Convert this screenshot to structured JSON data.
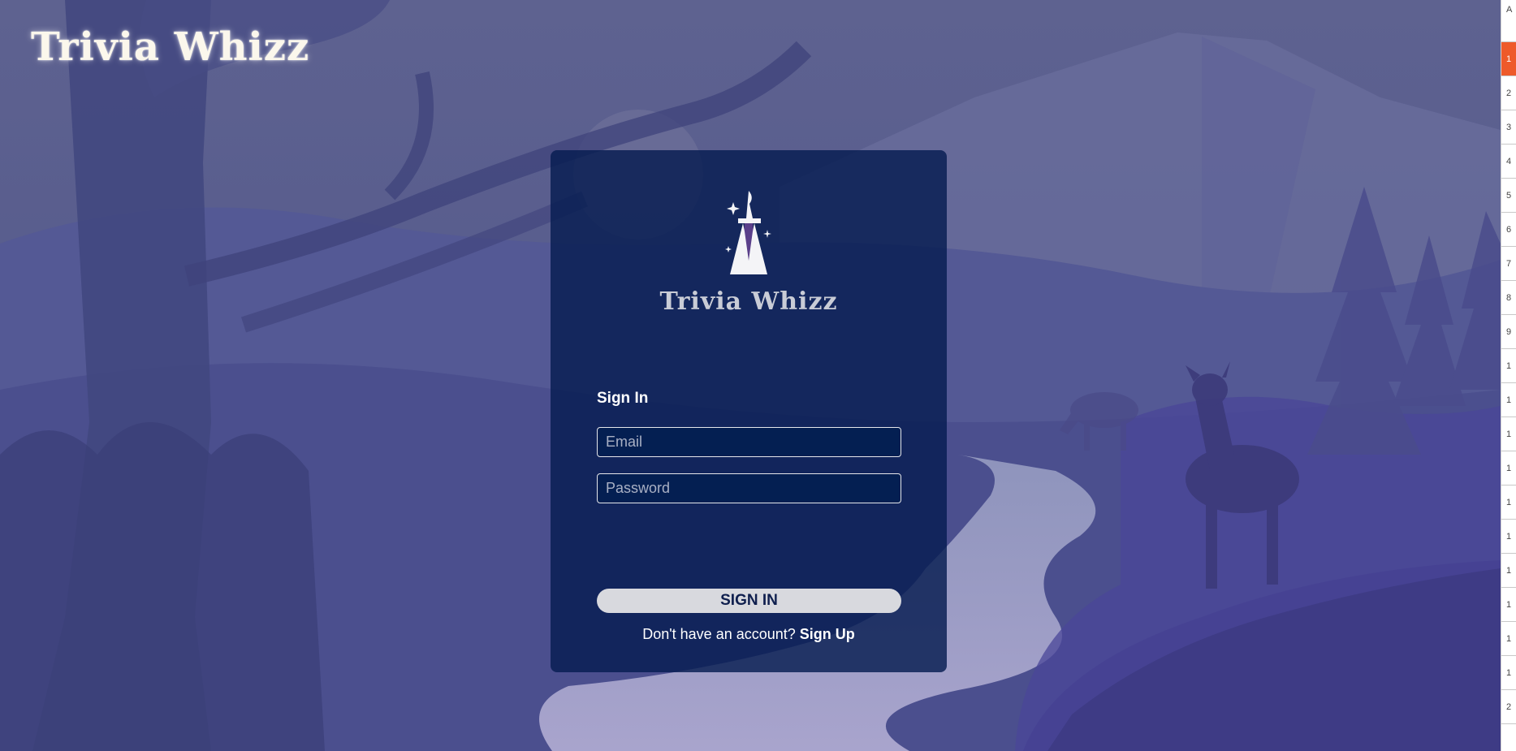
{
  "site": {
    "title": "Trivia Whizz"
  },
  "card": {
    "logo_text": "Trivia Whizz",
    "heading": "Sign In",
    "email": {
      "placeholder": "Email",
      "value": ""
    },
    "password": {
      "placeholder": "Password",
      "value": ""
    },
    "submit_label": "SIGN IN",
    "signup_prompt": "Don't have an account?",
    "signup_link": "Sign Up"
  },
  "side_panel": {
    "top_label": "A",
    "rows": [
      "1",
      "2",
      "3",
      "4",
      "5",
      "6",
      "7",
      "8",
      "9",
      "1",
      "1",
      "1",
      "1",
      "1",
      "1",
      "1",
      "1",
      "1",
      "1",
      "2"
    ]
  },
  "colors": {
    "sky": "#5d6192",
    "card_bg": "#061c50",
    "button_bg": "#d8d9de",
    "button_text": "#0f1f4e",
    "accent_active": "#ee5a2a"
  }
}
